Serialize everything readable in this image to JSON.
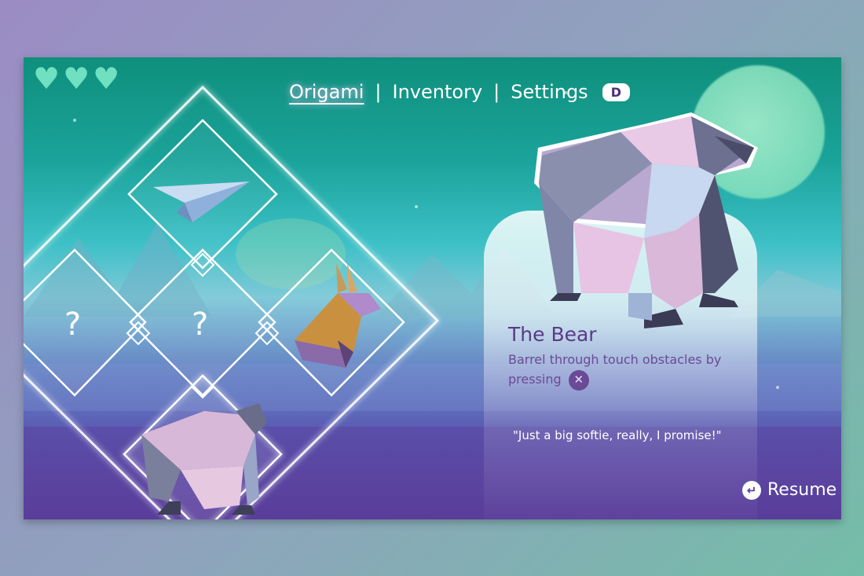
{
  "hud": {
    "hearts": [
      "♥",
      "♥",
      "♥"
    ]
  },
  "nav": {
    "tabs": [
      {
        "label": "Origami",
        "active": true
      },
      {
        "label": "Inventory",
        "active": false
      },
      {
        "label": "Settings",
        "active": false
      }
    ],
    "separator": "|",
    "key_hint": "D"
  },
  "grid": {
    "slots": [
      {
        "name": "paper-plane",
        "unlocked": true
      },
      {
        "name": "unknown",
        "unlocked": false,
        "label": "?"
      },
      {
        "name": "unknown",
        "unlocked": false,
        "label": "?"
      },
      {
        "name": "rabbit",
        "unlocked": true
      },
      {
        "name": "bear",
        "unlocked": true,
        "selected": true
      }
    ]
  },
  "detail": {
    "name": "The Bear",
    "description": "Barrel through touch obstacles by pressing",
    "button_icon": "✕",
    "quote": "\"Just a big softie, really, I promise!\""
  },
  "footer": {
    "resume_icon": "↵",
    "resume_label": "Resume"
  },
  "colors": {
    "accent": "#5a3a86",
    "heart": "#6fe0c0",
    "moon": "#8fe6c2"
  }
}
